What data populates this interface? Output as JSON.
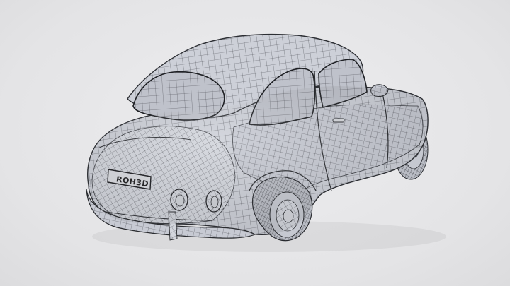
{
  "image": {
    "subject": "wireframe-car-model",
    "background_color": "#e6e6e8",
    "mesh_fill": "#c9ccd3",
    "mesh_line": "#3a3c42",
    "license_plate": {
      "text": "ROH3D"
    }
  }
}
